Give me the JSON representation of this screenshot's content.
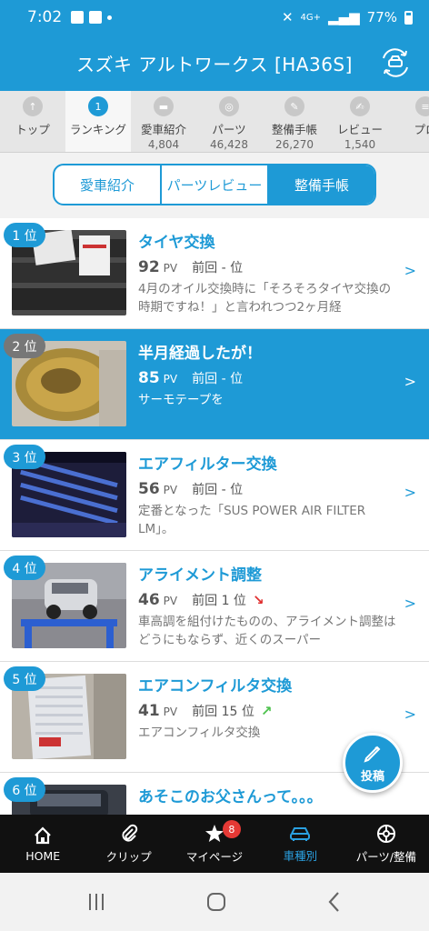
{
  "status_bar": {
    "time": "7:02",
    "network": "4G+",
    "battery": "77%"
  },
  "header": {
    "title": "スズキ アルトワークス [HA36S]"
  },
  "category_tabs": [
    {
      "label": "トップ",
      "count": ""
    },
    {
      "label": "ランキング",
      "count": ""
    },
    {
      "label": "愛車紹介",
      "count": "4,804"
    },
    {
      "label": "パーツ",
      "count": "46,428"
    },
    {
      "label": "整備手帳",
      "count": "26,270"
    },
    {
      "label": "レビュー",
      "count": "1,540"
    },
    {
      "label": "プロ",
      "count": ""
    }
  ],
  "segment": {
    "options": [
      "愛車紹介",
      "パーツレビュー",
      "整備手帳"
    ],
    "selected": "整備手帳"
  },
  "ranking": [
    {
      "rank": "1 位",
      "title": "タイヤ交換",
      "pv": "92",
      "pv_unit": "PV",
      "prev": "前回 - 位",
      "trend": "",
      "desc": "4月のオイル交換時に「そろそろタイヤ交換の時期ですね！」と言われつつ2ヶ月経"
    },
    {
      "rank": "2 位",
      "title": "半月経過したが！",
      "pv": "85",
      "pv_unit": "PV",
      "prev": "前回 - 位",
      "trend": "",
      "desc": "サーモテープを"
    },
    {
      "rank": "3 位",
      "title": "エアフィルター交換",
      "pv": "56",
      "pv_unit": "PV",
      "prev": "前回 - 位",
      "trend": "",
      "desc": "定番となった「SUS POWER AIR FILTER LM」。"
    },
    {
      "rank": "4 位",
      "title": "アライメント調整",
      "pv": "46",
      "pv_unit": "PV",
      "prev": "前回 1 位",
      "trend": "down",
      "desc": "車高調を組付けたものの、アライメント調整はどうにもならず、近くのスーパー"
    },
    {
      "rank": "5 位",
      "title": "エアコンフィルタ交換",
      "pv": "41",
      "pv_unit": "PV",
      "prev": "前回 15 位",
      "trend": "up",
      "desc": "エアコンフィルタ交換"
    },
    {
      "rank": "6 位",
      "title": "あそこのお父さんって。。。",
      "pv": "",
      "pv_unit": "",
      "prev": "",
      "trend": "",
      "desc": ""
    }
  ],
  "fab": {
    "label": "投稿"
  },
  "bottom_nav": [
    {
      "label": "HOME",
      "icon": "home-icon"
    },
    {
      "label": "クリップ",
      "icon": "clip-icon"
    },
    {
      "label": "マイページ",
      "icon": "star-icon",
      "badge": "8"
    },
    {
      "label": "車種別",
      "icon": "car-icon"
    },
    {
      "label": "パーツ/整備",
      "icon": "wheel-icon"
    }
  ],
  "colors": {
    "accent": "#1e9ad6",
    "down": "#e03030",
    "up": "#4cc14c",
    "badge": "#e53935"
  }
}
